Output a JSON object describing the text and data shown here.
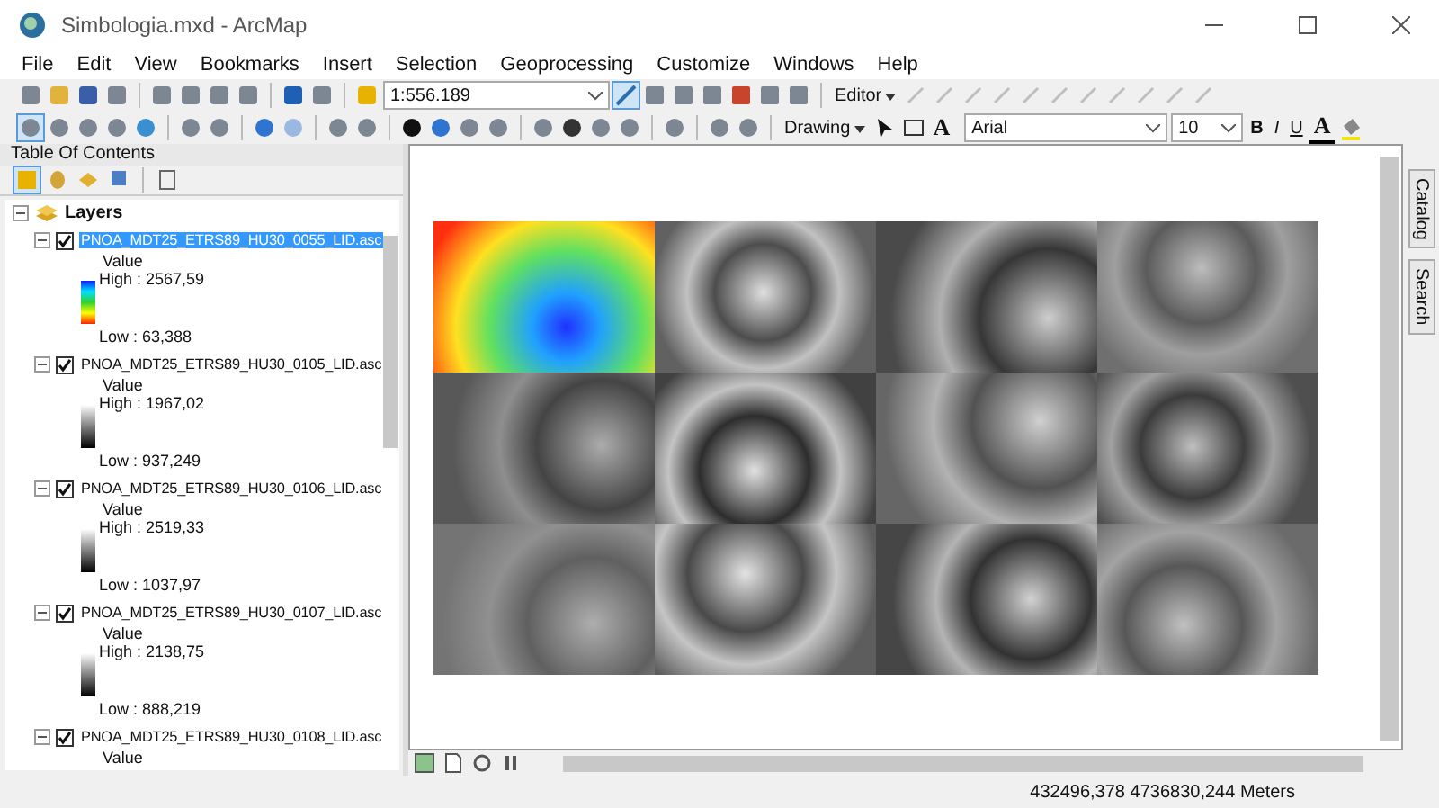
{
  "window": {
    "title": "Simbologia.mxd - ArcMap"
  },
  "menu": [
    "File",
    "Edit",
    "View",
    "Bookmarks",
    "Insert",
    "Selection",
    "Geoprocessing",
    "Customize",
    "Windows",
    "Help"
  ],
  "toolbar": {
    "scale": "1:556.189",
    "editor": "Editor",
    "drawing": "Drawing",
    "font": "Arial",
    "font_size": "10",
    "bold": "B",
    "italic": "I",
    "underline": "U",
    "text_tool": "A",
    "font_color": "A"
  },
  "toc": {
    "title": "Table Of Contents",
    "root": {
      "label": "Layers",
      "expanded": true
    },
    "layers": [
      {
        "name": "PNOA_MDT25_ETRS89_HU30_0055_LID.asc",
        "checked": true,
        "selected": true,
        "expanded": true,
        "legend": {
          "heading": "Value",
          "high": "High : 2567,59",
          "low": "Low : 63,388",
          "kind": "color"
        }
      },
      {
        "name": "PNOA_MDT25_ETRS89_HU30_0105_LID.asc",
        "checked": true,
        "selected": false,
        "expanded": true,
        "legend": {
          "heading": "Value",
          "high": "High : 1967,02",
          "low": "Low : 937,249",
          "kind": "gray"
        }
      },
      {
        "name": "PNOA_MDT25_ETRS89_HU30_0106_LID.asc",
        "checked": true,
        "selected": false,
        "expanded": true,
        "legend": {
          "heading": "Value",
          "high": "High : 2519,33",
          "low": "Low : 1037,97",
          "kind": "gray"
        }
      },
      {
        "name": "PNOA_MDT25_ETRS89_HU30_0107_LID.asc",
        "checked": true,
        "selected": false,
        "expanded": true,
        "legend": {
          "heading": "Value",
          "high": "High : 2138,75",
          "low": "Low : 888,219",
          "kind": "gray"
        }
      },
      {
        "name": "PNOA_MDT25_ETRS89_HU30_0108_LID.asc",
        "checked": true,
        "selected": false,
        "expanded": true,
        "legend": {
          "heading": "Value"
        }
      }
    ]
  },
  "dock_tabs": [
    "Catalog",
    "Search"
  ],
  "status_bar": {
    "coordinates": "432496,378  4736830,244 Meters"
  }
}
